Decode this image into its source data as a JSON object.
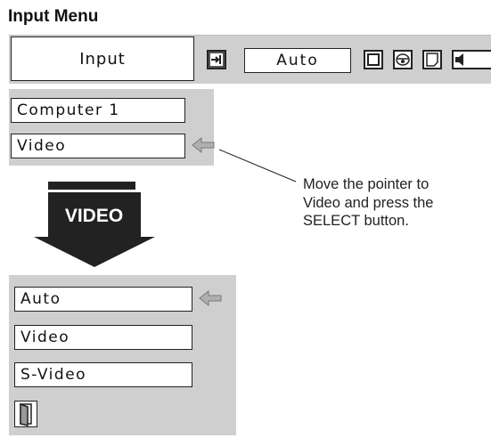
{
  "title": "Input Menu",
  "menubar": {
    "input_tab": "Input",
    "mode_value": "Auto"
  },
  "source_list": {
    "items": [
      "Computer 1",
      "Video"
    ],
    "selected_index": 1
  },
  "transition_label": "VIDEO",
  "callout": {
    "lines": [
      "Move the pointer to",
      "Video and press the",
      "SELECT button."
    ]
  },
  "video_list": {
    "items": [
      "Auto",
      "Video",
      "S-Video"
    ],
    "selected_index": 0,
    "exit_icon": "door-exit-icon"
  },
  "colors": {
    "panel": "#cfcfcf",
    "pointer": "#b0b0b0",
    "arrow": "#222222"
  }
}
